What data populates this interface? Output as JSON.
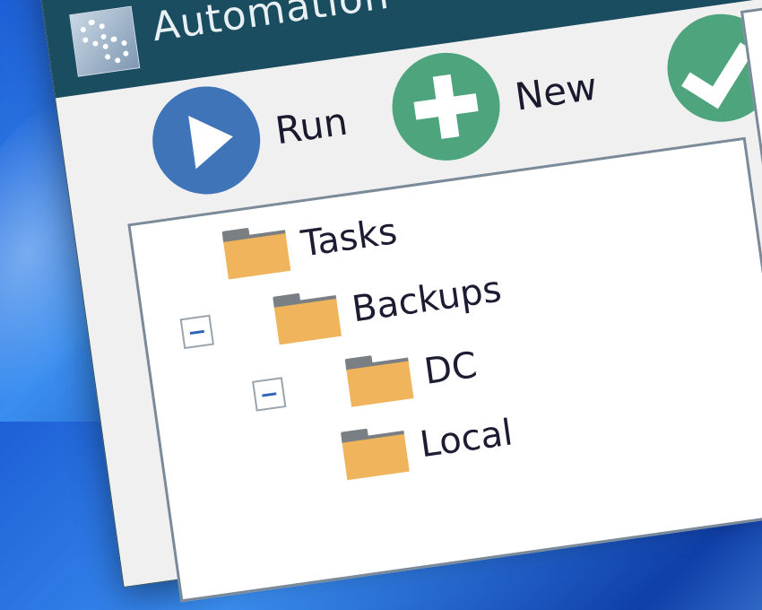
{
  "window": {
    "title": "Automation",
    "icon": "gears-icon"
  },
  "toolbar": {
    "run_label": "Run",
    "new_label": "New",
    "ok_icon": "checkmark-icon"
  },
  "tree": {
    "items": [
      {
        "label": "Tasks",
        "icon": "folder-icon"
      },
      {
        "label": "Backups",
        "icon": "folder-icon"
      },
      {
        "label": "DC",
        "icon": "folder-icon"
      },
      {
        "label": "Local",
        "icon": "folder-icon"
      }
    ]
  },
  "colors": {
    "titlebar": "#1b4d60",
    "run_button": "#3f74b8",
    "new_button": "#4da47d",
    "folder": "#efb45c",
    "expander_minus": "#2e63b8"
  }
}
